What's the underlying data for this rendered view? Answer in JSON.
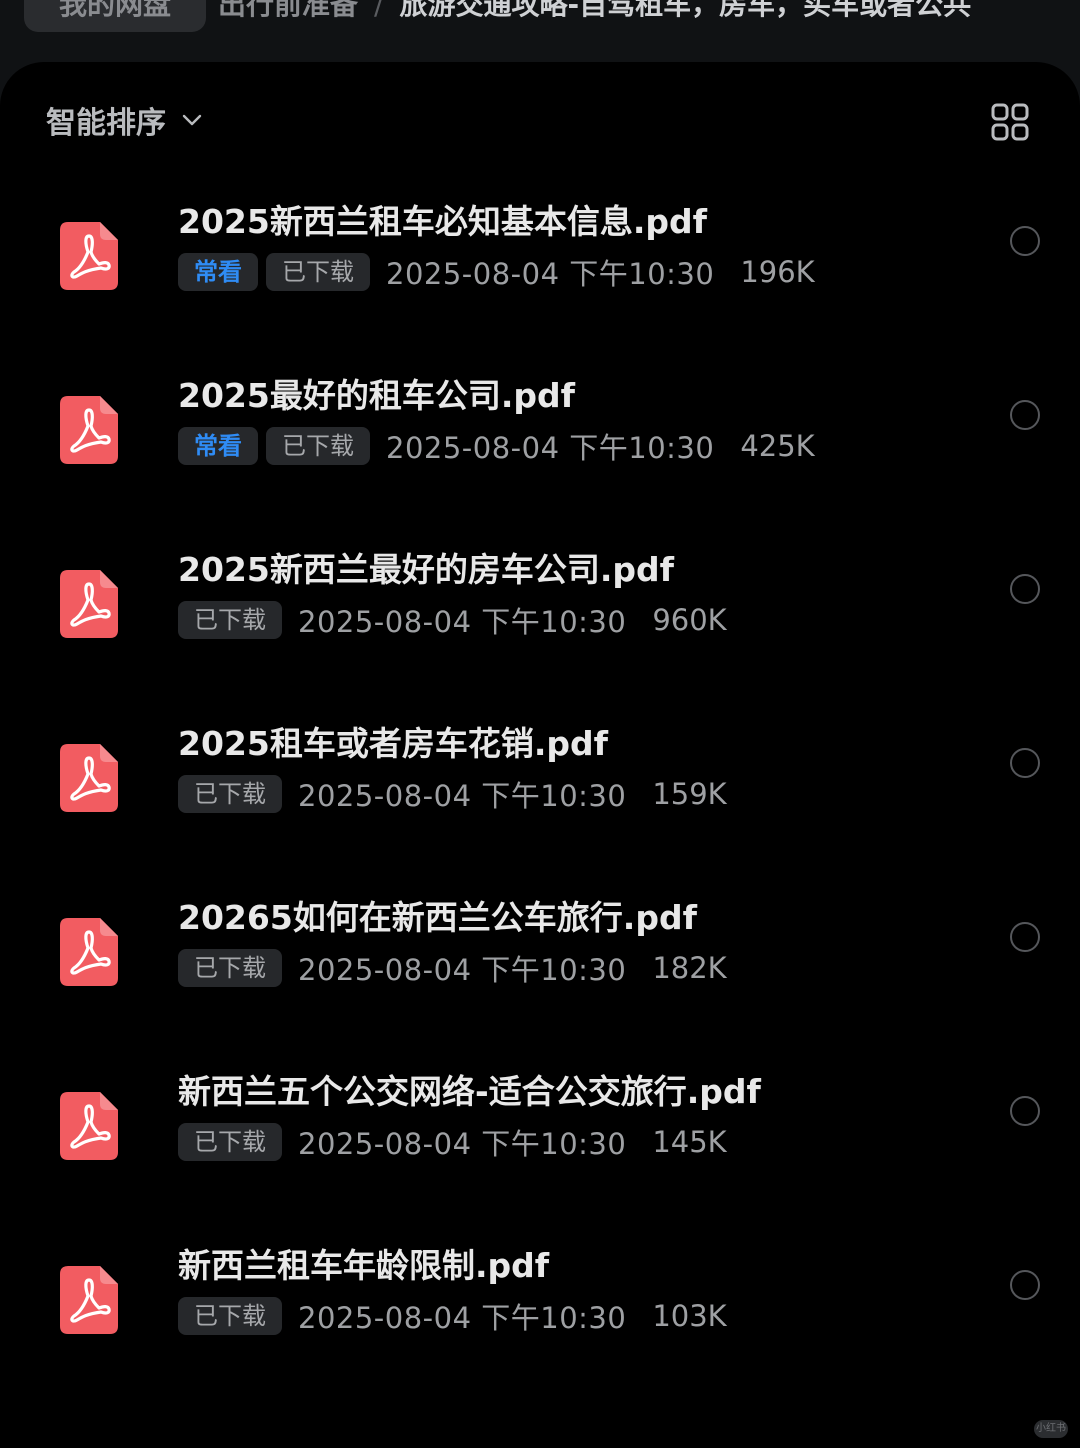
{
  "breadcrumb": {
    "root": "我的网盘",
    "middle": "出行前准备",
    "separator": "/",
    "current": "旅游交通攻略-自驾租车，房车，买车或者公共"
  },
  "toolbar": {
    "sort_label": "智能排序"
  },
  "tags": {
    "frequent": "常看",
    "downloaded": "已下载"
  },
  "files": [
    {
      "name": "2025新西兰租车必知基本信息.pdf",
      "frequent": true,
      "date": "2025-08-04 下午10:30",
      "size": "196K"
    },
    {
      "name": "2025最好的租车公司.pdf",
      "frequent": true,
      "date": "2025-08-04 下午10:30",
      "size": "425K"
    },
    {
      "name": "2025新西兰最好的房车公司.pdf",
      "frequent": false,
      "date": "2025-08-04 下午10:30",
      "size": "960K"
    },
    {
      "name": "2025租车或者房车花销.pdf",
      "frequent": false,
      "date": "2025-08-04 下午10:30",
      "size": "159K"
    },
    {
      "name": "20265如何在新西兰公车旅行.pdf",
      "frequent": false,
      "date": "2025-08-04 下午10:30",
      "size": "182K"
    },
    {
      "name": "新西兰五个公交网络-适合公交旅行.pdf",
      "frequent": false,
      "date": "2025-08-04 下午10:30",
      "size": "145K"
    },
    {
      "name": "新西兰租车年龄限制.pdf",
      "frequent": false,
      "date": "2025-08-04 下午10:30",
      "size": "103K"
    }
  ],
  "watermark": "小红书",
  "colors": {
    "pdf_icon": "#f25c61",
    "frequent_tag": "#2f8cf5",
    "background": "#000000"
  },
  "icons": {
    "file": "pdf-icon",
    "sort": "chevron-down-icon",
    "view": "grid-view-icon",
    "select": "radio-circle-icon"
  }
}
